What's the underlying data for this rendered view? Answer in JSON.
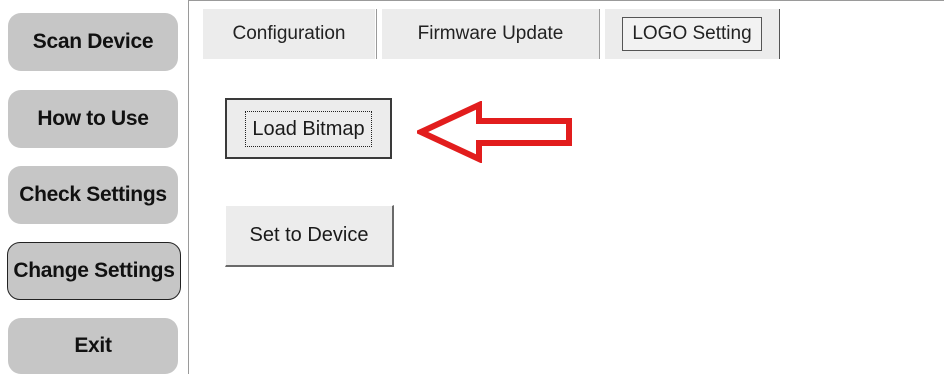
{
  "sidebar": {
    "buttons": [
      {
        "label": "Scan Device"
      },
      {
        "label": "How to Use"
      },
      {
        "label": "Check Settings"
      },
      {
        "label": "Change Settings"
      },
      {
        "label": "Exit"
      }
    ],
    "active": "Change Settings"
  },
  "tabs": [
    {
      "label": "Configuration"
    },
    {
      "label": "Firmware Update"
    },
    {
      "label": "LOGO Setting"
    }
  ],
  "selected_tab": "LOGO Setting",
  "logo_setting": {
    "load_bitmap_label": "Load Bitmap",
    "set_to_device_label": "Set to Device"
  },
  "annotation": {
    "arrow_color": "#e21d1d",
    "icon": "left-arrow-icon"
  },
  "colors": {
    "sidebar_button_bg": "#c6c6c6",
    "tab_bg": "#ececec",
    "button_bg": "#ececec"
  }
}
